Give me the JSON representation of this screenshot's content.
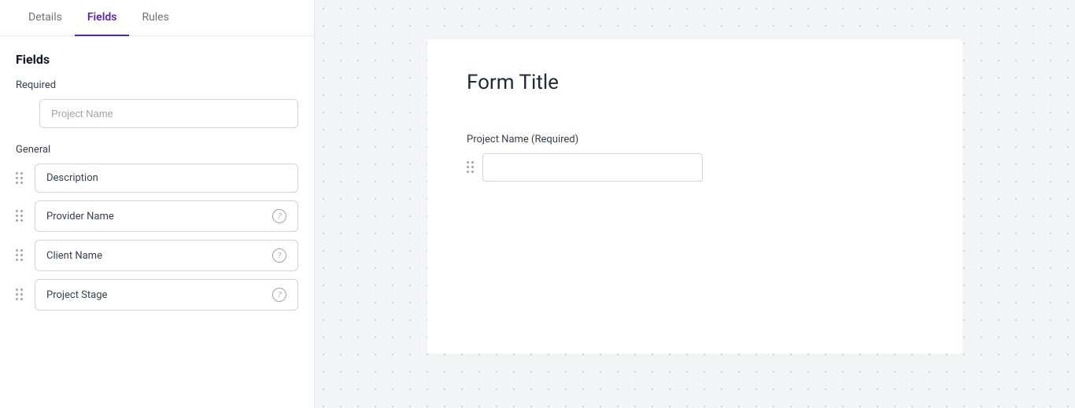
{
  "tabs": [
    {
      "id": "details",
      "label": "Details",
      "active": false
    },
    {
      "id": "fields",
      "label": "Fields",
      "active": true
    },
    {
      "id": "rules",
      "label": "Rules",
      "active": false
    }
  ],
  "sidebar": {
    "heading": "Fields",
    "required_section_label": "Required",
    "general_section_label": "General",
    "required_fields": [
      {
        "id": "project-name",
        "placeholder": "Project Name",
        "has_help": false
      }
    ],
    "general_fields": [
      {
        "id": "description",
        "label": "Description",
        "has_help": false
      },
      {
        "id": "provider-name",
        "label": "Provider Name",
        "has_help": true
      },
      {
        "id": "client-name",
        "label": "Client Name",
        "has_help": true
      },
      {
        "id": "project-stage",
        "label": "Project Stage",
        "has_help": true
      }
    ]
  },
  "canvas": {
    "form_title": "Form Title",
    "field_label": "Project Name (Required)"
  },
  "icons": {
    "help": "?"
  }
}
